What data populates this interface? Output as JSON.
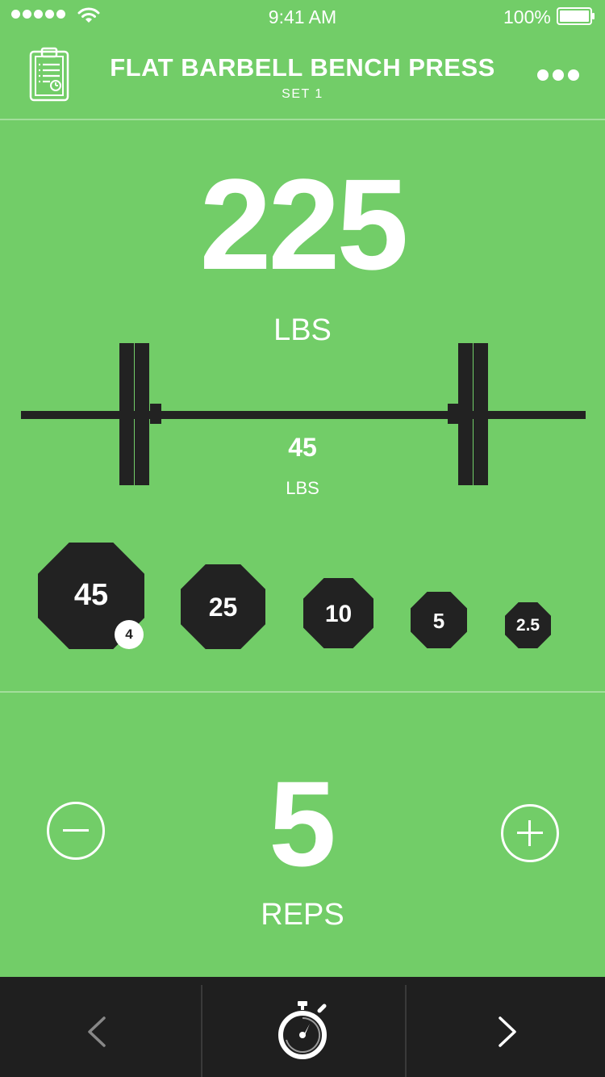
{
  "status_bar": {
    "time": "9:41 AM",
    "battery_percent": "100%"
  },
  "header": {
    "title": "FLAT BARBELL BENCH PRESS",
    "subtitle": "SET 1",
    "left_icon": "clipboard-icon",
    "right_icon": "more-icon"
  },
  "weight": {
    "value": "225",
    "unit": "LBS"
  },
  "bar": {
    "value": "45",
    "unit": "LBS"
  },
  "plates": [
    {
      "label": "45",
      "count": "4"
    },
    {
      "label": "25"
    },
    {
      "label": "10"
    },
    {
      "label": "5"
    },
    {
      "label": "2.5"
    }
  ],
  "reps": {
    "value": "5",
    "unit": "REPS",
    "decrement_icon": "minus-icon",
    "increment_icon": "plus-icon"
  },
  "tabbar": {
    "prev_icon": "chevron-left-icon",
    "timer_icon": "stopwatch-icon",
    "next_icon": "chevron-right-icon"
  },
  "colors": {
    "background": "#72CD68",
    "dark": "#222222",
    "tabbar": "#1F1F1F"
  }
}
